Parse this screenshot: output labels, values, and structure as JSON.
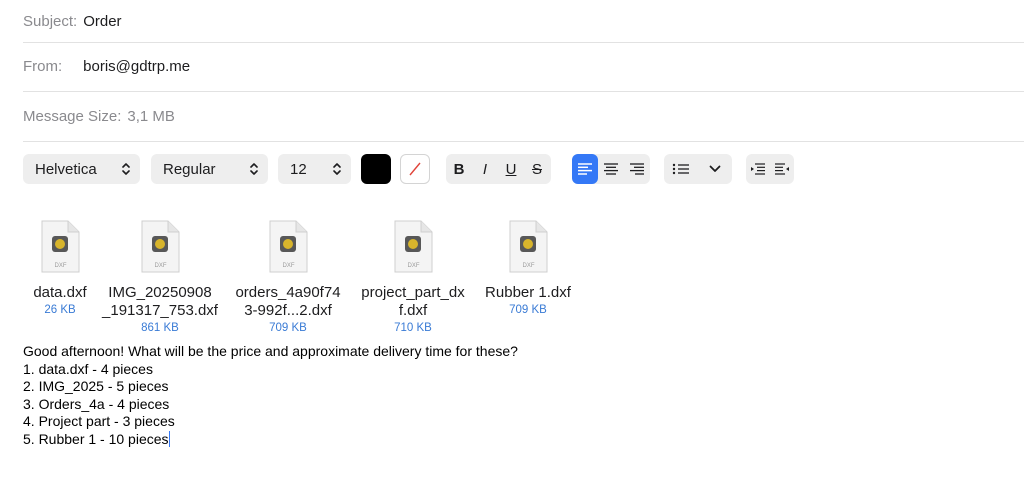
{
  "header": {
    "subject_label": "Subject:",
    "subject_value": "Order",
    "from_label": "From:",
    "from_value": "boris@gdtrp.me",
    "size_label": "Message Size:",
    "size_value": "3,1 MB"
  },
  "toolbar": {
    "font_family": "Helvetica",
    "font_style": "Regular",
    "font_size": "12",
    "text_color": "#000000",
    "bold": "B",
    "italic": "I",
    "underline": "U",
    "strike": "S",
    "active_alignment": "align-left",
    "accent_color": "#3478f6"
  },
  "attachments": [
    {
      "line1": "data.dxf",
      "line2": "",
      "size": "26 KB",
      "badge": "DXF"
    },
    {
      "line1": "IMG_20250908",
      "line2": "_191317_753.dxf",
      "size": "861 KB",
      "badge": "DXF"
    },
    {
      "line1": "orders_4a90f74",
      "line2": "3-992f...2.dxf",
      "size": "709 KB",
      "badge": "DXF"
    },
    {
      "line1": "project_part_dx",
      "line2": "f.dxf",
      "size": "710 KB",
      "badge": "DXF"
    },
    {
      "line1": "Rubber 1.dxf",
      "line2": "",
      "size": "709 KB",
      "badge": "DXF"
    }
  ],
  "message": {
    "lines": [
      "Good afternoon! What will be the price and approximate delivery time for these?",
      "1. data.dxf - 4 pieces",
      "2. IMG_2025 - 5 pieces",
      "3. Orders_4a - 4 pieces",
      "4. Project part - 3 pieces",
      "5. Rubber 1 - 10 pieces"
    ]
  }
}
